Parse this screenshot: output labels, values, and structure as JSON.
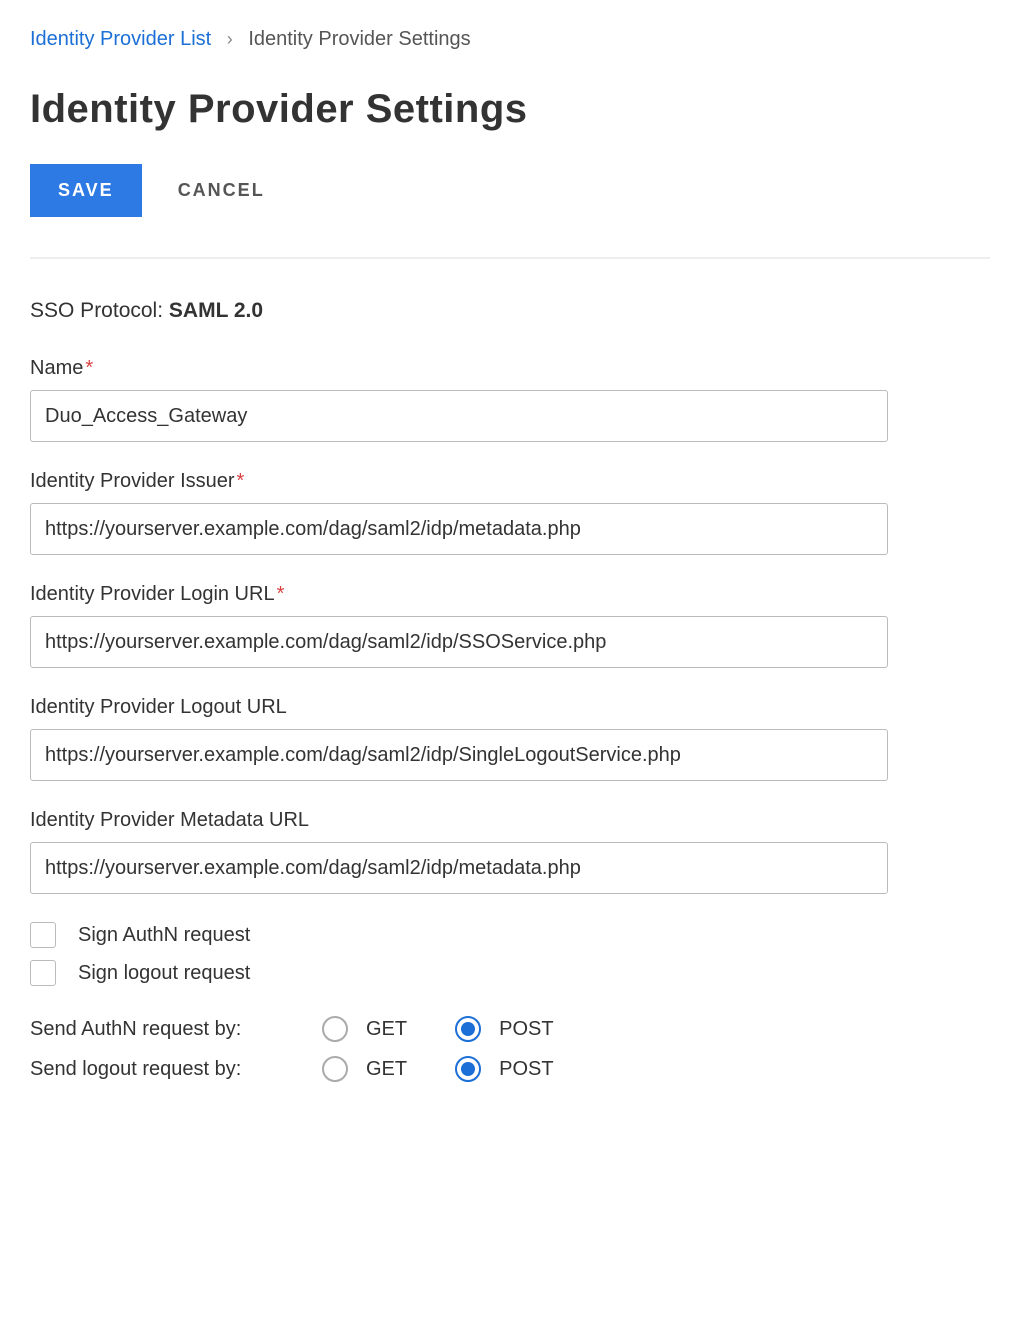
{
  "breadcrumb": {
    "parent": "Identity Provider List",
    "current": "Identity Provider Settings"
  },
  "page_title": "Identity Provider Settings",
  "actions": {
    "save": "SAVE",
    "cancel": "CANCEL"
  },
  "sso_protocol": {
    "label": "SSO Protocol:",
    "value": "SAML 2.0"
  },
  "fields": {
    "name": {
      "label": "Name",
      "required": true,
      "value": "Duo_Access_Gateway"
    },
    "issuer": {
      "label": "Identity Provider Issuer",
      "required": true,
      "value": "https://yourserver.example.com/dag/saml2/idp/metadata.php"
    },
    "login_url": {
      "label": "Identity Provider Login URL",
      "required": true,
      "value": "https://yourserver.example.com/dag/saml2/idp/SSOService.php"
    },
    "logout_url": {
      "label": "Identity Provider Logout URL",
      "required": false,
      "value": "https://yourserver.example.com/dag/saml2/idp/SingleLogoutService.php"
    },
    "metadata_url": {
      "label": "Identity Provider Metadata URL",
      "required": false,
      "value": "https://yourserver.example.com/dag/saml2/idp/metadata.php"
    }
  },
  "checkboxes": {
    "sign_authn": {
      "label": "Sign AuthN request",
      "checked": false
    },
    "sign_logout": {
      "label": "Sign logout request",
      "checked": false
    }
  },
  "radios": {
    "authn": {
      "label": "Send AuthN request by:",
      "options": {
        "get": "GET",
        "post": "POST"
      },
      "selected": "post"
    },
    "logout": {
      "label": "Send logout request by:",
      "options": {
        "get": "GET",
        "post": "POST"
      },
      "selected": "post"
    }
  }
}
